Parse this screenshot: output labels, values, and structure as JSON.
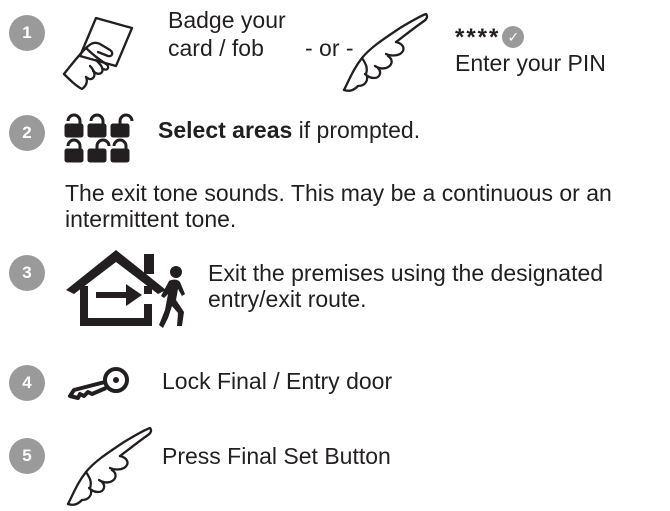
{
  "steps": [
    {
      "number": "1",
      "badge_label": "Badge your",
      "badge_label_2": "card / fob",
      "or_label": "- or -",
      "pin_mask": "****",
      "enter_label": "Enter your PIN"
    },
    {
      "number": "2",
      "label_bold": "Select areas",
      "label_rest": " if prompted.",
      "note": "The exit tone sounds. This may be a continuous or an intermittent tone."
    },
    {
      "number": "3",
      "label": "Exit the premises using the designated entry/exit route."
    },
    {
      "number": "4",
      "label": "Lock Final / Entry door"
    },
    {
      "number": "5",
      "label": "Press Final Set Button"
    }
  ],
  "colors": {
    "badge": "#9a9a9a",
    "text": "#231f20"
  },
  "icons": {
    "step1": [
      "card-in-hand-icon",
      "pointing-hand-icon",
      "enter-tick-icon"
    ],
    "step2": [
      "padlock-icons"
    ],
    "step3": [
      "exit-house-icon"
    ],
    "step4": [
      "key-icon"
    ],
    "step5": [
      "pointing-hand-icon"
    ]
  }
}
